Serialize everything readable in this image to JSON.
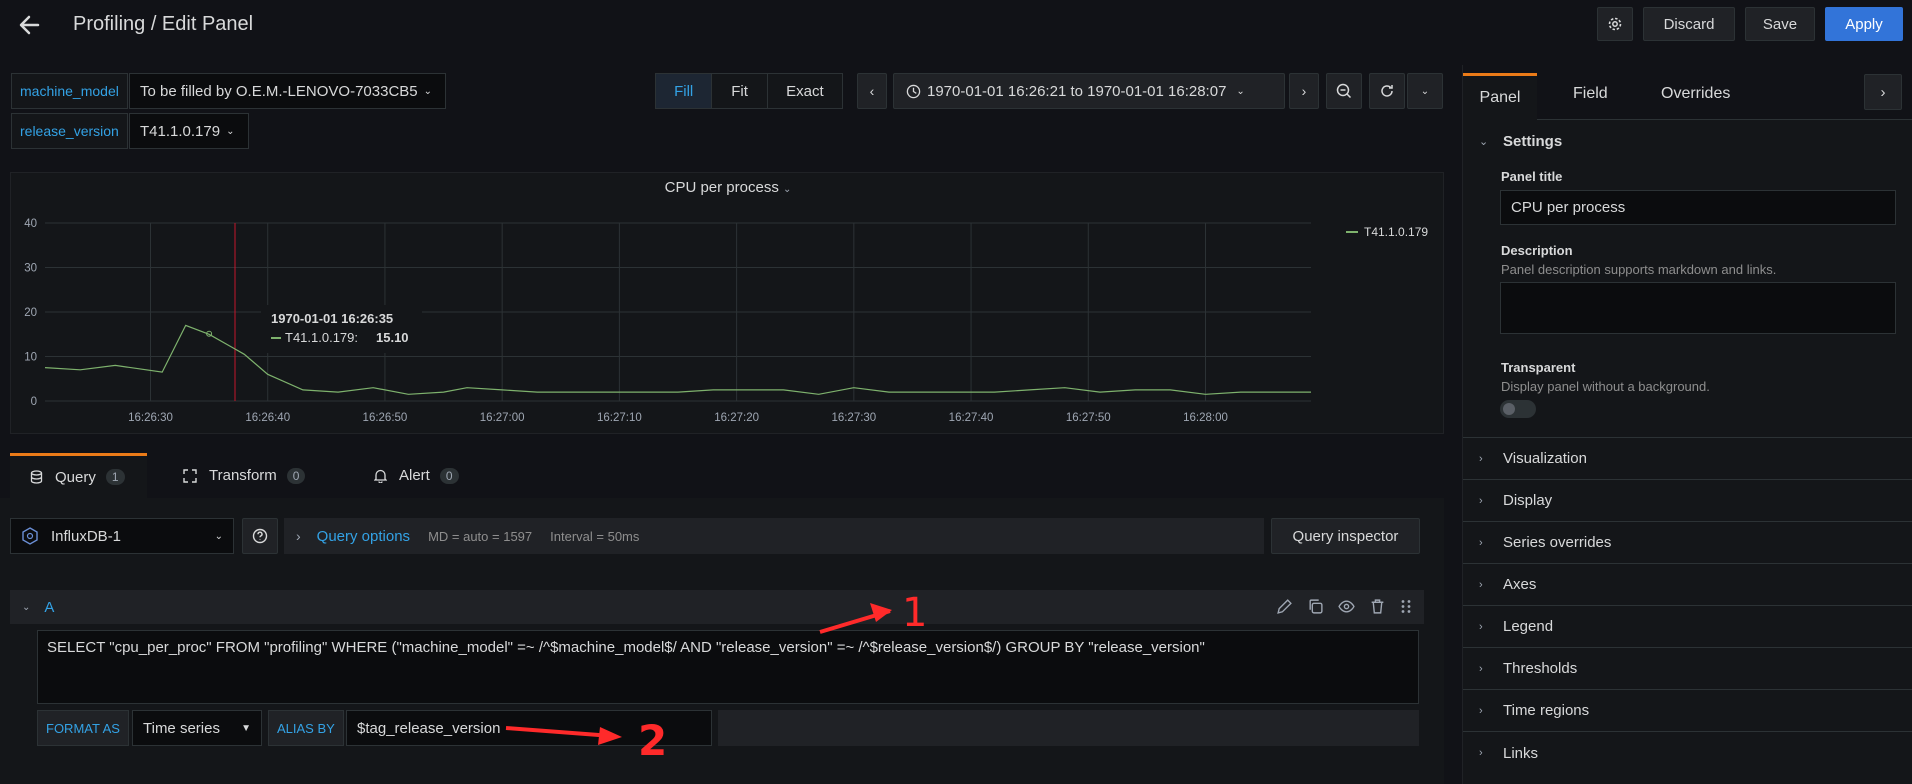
{
  "header": {
    "title": "Profiling / Edit Panel",
    "discard_label": "Discard",
    "save_label": "Save",
    "apply_label": "Apply"
  },
  "variables": [
    {
      "name": "machine_model",
      "value": "To be filled by O.E.M.-LENOVO-7033CB5"
    },
    {
      "name": "release_version",
      "value": "T41.1.0.179"
    }
  ],
  "time_fit": {
    "fill": "Fill",
    "fit": "Fit",
    "exact": "Exact"
  },
  "time_range": "1970-01-01 16:26:21 to 1970-01-01 16:28:07",
  "panel": {
    "title": "CPU per process",
    "tooltip": {
      "time": "1970-01-01 16:26:35",
      "series": "T41.1.0.179:",
      "value": "15.10"
    }
  },
  "chart_data": {
    "type": "line",
    "title": "CPU per process",
    "x_ticks": [
      "16:26:30",
      "16:26:40",
      "16:26:50",
      "16:27:00",
      "16:27:10",
      "16:27:20",
      "16:27:30",
      "16:27:40",
      "16:27:50",
      "16:28:00"
    ],
    "y_ticks": [
      "0",
      "10",
      "20",
      "30",
      "40"
    ],
    "ylim": [
      0,
      40
    ],
    "xlim_seconds": [
      21,
      129
    ],
    "series": [
      {
        "name": "T41.1.0.179",
        "color": "#7eb26d",
        "x": [
          21,
          24,
          27,
          31,
          33,
          35,
          37,
          38,
          40,
          43,
          46,
          49,
          52,
          55,
          57,
          60,
          63,
          66,
          69,
          72,
          75,
          78,
          81,
          84,
          87,
          90,
          93,
          96,
          99,
          102,
          105,
          108,
          111,
          114,
          117,
          120,
          123,
          126,
          129
        ],
        "y": [
          7.5,
          7,
          8,
          6.5,
          17,
          15,
          12,
          10.5,
          6,
          2.5,
          2,
          3,
          1.5,
          2,
          3,
          2.5,
          2,
          2,
          2,
          2,
          2,
          2.5,
          2.5,
          2.5,
          1.5,
          3,
          2,
          2,
          2,
          2,
          2.5,
          3,
          2,
          2.5,
          2.5,
          1.5,
          2,
          2,
          2
        ]
      }
    ],
    "legend": "right",
    "grid": true
  },
  "tabs": {
    "query": "Query",
    "query_count": "1",
    "transform": "Transform",
    "transform_count": "0",
    "alert": "Alert",
    "alert_count": "0"
  },
  "datasource": {
    "name": "InfluxDB-1",
    "options_label": "Query options",
    "md": "MD = auto = 1597",
    "interval": "Interval = 50ms",
    "inspector_label": "Query inspector"
  },
  "query": {
    "ref_id": "A",
    "text": "SELECT \"cpu_per_proc\" FROM \"profiling\" WHERE (\"machine_model\" =~ /^$machine_model$/ AND \"release_version\" =~ /^$release_version$/) GROUP BY \"release_version\"",
    "format_label": "FORMAT AS",
    "format_value": "Time series",
    "alias_label": "ALIAS BY",
    "alias_value": "$tag_release_version"
  },
  "annotations": {
    "one": "1",
    "two": "2"
  },
  "side": {
    "tabs": {
      "panel": "Panel",
      "field": "Field",
      "overrides": "Overrides"
    },
    "settings": "Settings",
    "panel_title_label": "Panel title",
    "panel_title_value": "CPU per process",
    "description_label": "Description",
    "description_help": "Panel description supports markdown and links.",
    "transparent_label": "Transparent",
    "transparent_help": "Display panel without a background.",
    "sections": [
      "Visualization",
      "Display",
      "Series overrides",
      "Axes",
      "Legend",
      "Thresholds",
      "Time regions",
      "Links"
    ]
  },
  "colors": {
    "accent": "#3274d9",
    "tab_active": "#eb7b18",
    "link": "#33a2e5",
    "series": "#7eb26d"
  }
}
